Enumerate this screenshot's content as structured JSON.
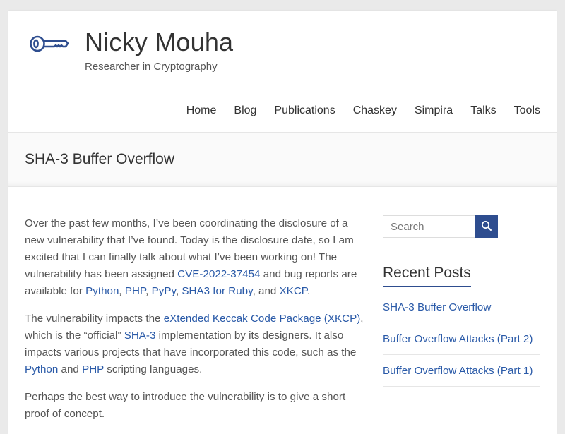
{
  "site": {
    "title": "Nicky Mouha",
    "tagline": "Researcher in Cryptography",
    "logo_icon": "key-icon"
  },
  "nav": {
    "items": [
      "Home",
      "Blog",
      "Publications",
      "Chaskey",
      "Simpira",
      "Talks",
      "Tools"
    ]
  },
  "page": {
    "title": "SHA-3 Buffer Overflow"
  },
  "article": {
    "p1": {
      "t1": "Over the past few months, I’ve been coordinating the disclosure of a new vulnerability that I’ve found. Today is the disclosure date, so I am excited that I can finally talk about what I’ve been working on! The vulnerability has been assigned ",
      "cve": "CVE-2022-37454",
      "t2": " and bug reports are available for ",
      "python": "Python",
      "c1": ", ",
      "php": "PHP",
      "c2": ", ",
      "pypy": "PyPy",
      "c3": ", ",
      "ruby": "SHA3 for Ruby",
      "t3": ", and ",
      "xkcp": "XKCP",
      "t4": "."
    },
    "p2": {
      "t1": "The vulnerability impacts the ",
      "xkcp_full": "eXtended Keccak Code Package (XKCP)",
      "t2": ", which is the “official” ",
      "sha3": "SHA-3",
      "t3": " implementation by its designers. It also impacts various projects that have incorporated this code, such as the ",
      "python": "Python",
      "t4": " and ",
      "php": "PHP",
      "t5": " scripting languages."
    },
    "p3": "Perhaps the best way to introduce the vulnerability is to give a short proof of concept."
  },
  "sidebar": {
    "search_placeholder": "Search",
    "search_icon": "search-icon",
    "recent_title": "Recent Posts",
    "recent_posts": [
      "SHA-3 Buffer Overflow",
      "Buffer Overflow Attacks (Part 2)",
      "Buffer Overflow Attacks (Part 1)"
    ]
  },
  "colors": {
    "accent": "#2e4d8f",
    "link": "#2a5aa8",
    "background": "#eaeaea"
  }
}
